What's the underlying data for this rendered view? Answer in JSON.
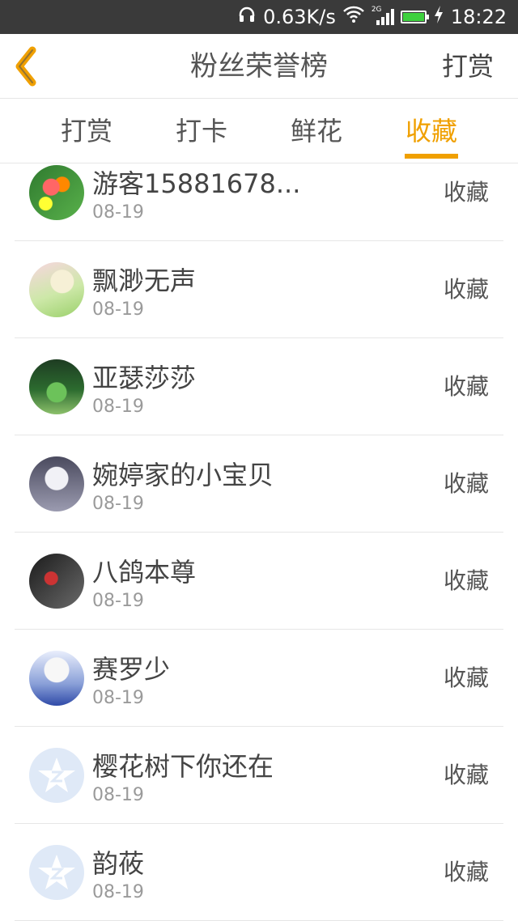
{
  "status_bar": {
    "speed": "0.63K/s",
    "network": "2G",
    "time": "18:22",
    "battery_color": "#3ed13e"
  },
  "header": {
    "title": "粉丝荣誉榜",
    "action": "打赏"
  },
  "tabs": [
    {
      "label": "打赏",
      "active": false
    },
    {
      "label": "打卡",
      "active": false
    },
    {
      "label": "鲜花",
      "active": false
    },
    {
      "label": "收藏",
      "active": true
    }
  ],
  "accent_color": "#f0a000",
  "items": [
    {
      "name": "游客15881678...",
      "date": "08-19",
      "action": "收藏",
      "avatar": "tulips"
    },
    {
      "name": "飘渺无声",
      "date": "08-19",
      "action": "收藏",
      "avatar": "anime-girl"
    },
    {
      "name": "亚瑟莎莎",
      "date": "08-19",
      "action": "收藏",
      "avatar": "forest"
    },
    {
      "name": "婉婷家的小宝贝",
      "date": "08-19",
      "action": "收藏",
      "avatar": "girl"
    },
    {
      "name": "八鸽本尊",
      "date": "08-19",
      "action": "收藏",
      "avatar": "dark-figure"
    },
    {
      "name": "赛罗少",
      "date": "08-19",
      "action": "收藏",
      "avatar": "anime-boy"
    },
    {
      "name": "樱花树下你还在",
      "date": "08-19",
      "action": "收藏",
      "avatar": "qq-default"
    },
    {
      "name": "韵莜",
      "date": "08-19",
      "action": "收藏",
      "avatar": "qq-default"
    }
  ]
}
